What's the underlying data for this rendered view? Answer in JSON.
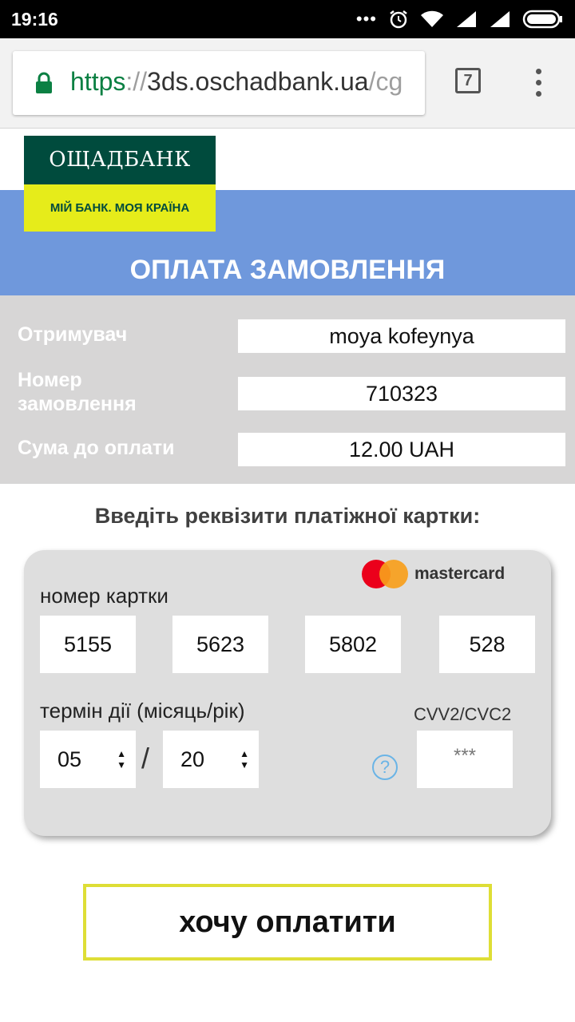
{
  "status_bar": {
    "time": "19:16"
  },
  "browser": {
    "url_scheme": "https",
    "url_sep": "://",
    "url_host": "3ds.oschadbank.ua",
    "url_path": "/cg",
    "tab_count": "7"
  },
  "logo": {
    "name": "ОЩАДБАНК",
    "slogan": "МІЙ БАНК. МОЯ КРАЇНА"
  },
  "page_title": "ОПЛАТА ЗАМОВЛЕННЯ",
  "order": {
    "recipient_label": "Отримувач",
    "recipient_value": "moya kofeynya",
    "order_number_label_line1": "Номер",
    "order_number_label_line2": "замовлення",
    "order_number_value": "710323",
    "amount_label": "Сума до оплати",
    "amount_value": "12.00 UAH"
  },
  "card_prompt": "Введіть реквізити платіжної картки:",
  "card": {
    "brand": "mastercard",
    "number_label": "номер картки",
    "number_parts": [
      "5155",
      "5623",
      "5802",
      "528"
    ],
    "expiry_label": "термін дії (місяць/рік)",
    "month": "05",
    "year": "20",
    "separator": "/",
    "cvv_label": "CVV2/CVC2",
    "cvv_placeholder": "***",
    "help_symbol": "?"
  },
  "pay_button": "хочу оплатити",
  "colors": {
    "brand_green": "#004b3d",
    "brand_yellow": "#e6ec1a",
    "title_band": "#6f98dc",
    "info_gray": "#d7d6d6",
    "button_border": "#dede36"
  }
}
